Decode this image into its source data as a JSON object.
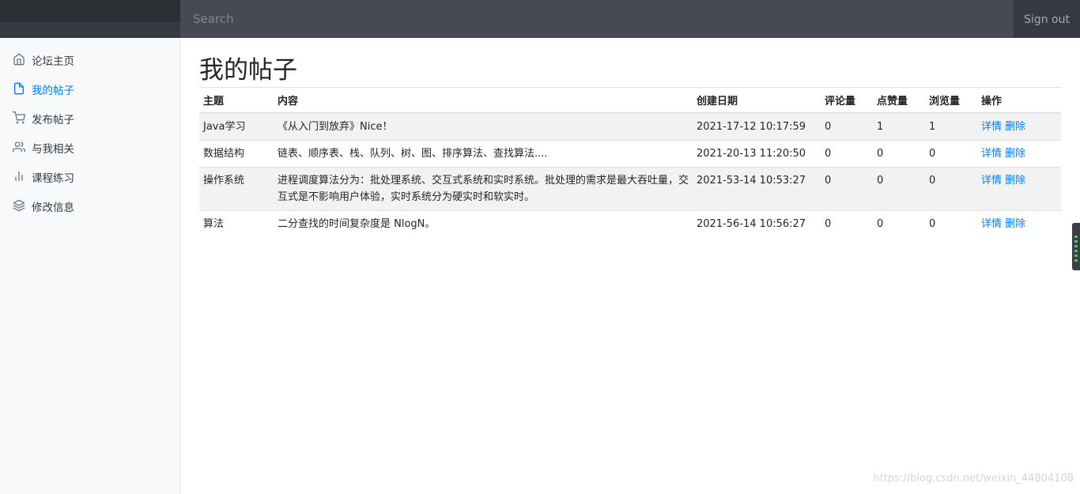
{
  "navbar": {
    "search_placeholder": "Search",
    "signout_label": "Sign out"
  },
  "sidebar": {
    "items": [
      {
        "label": "论坛主页",
        "icon": "home-icon",
        "active": false
      },
      {
        "label": "我的帖子",
        "icon": "file-icon",
        "active": true
      },
      {
        "label": "发布帖子",
        "icon": "shopping-cart-icon",
        "active": false
      },
      {
        "label": "与我相关",
        "icon": "users-icon",
        "active": false
      },
      {
        "label": "课程练习",
        "icon": "bar-chart-icon",
        "active": false
      },
      {
        "label": "修改信息",
        "icon": "layers-icon",
        "active": false
      }
    ]
  },
  "main": {
    "title": "我的帖子",
    "table": {
      "headers": [
        "主题",
        "内容",
        "创建日期",
        "评论量",
        "点赞量",
        "浏览量",
        "操作"
      ],
      "rows": [
        {
          "topic": "Java学习",
          "content": "《从入门到放弃》Nice！",
          "date": "2021-17-12 10:17:59",
          "comments": "0",
          "likes": "1",
          "views": "1",
          "detail": "详情",
          "delete": "删除"
        },
        {
          "topic": "数据结构",
          "content": "链表、顺序表、栈、队列、树、图、排序算法、查找算法....",
          "date": "2021-20-13 11:20:50",
          "comments": "0",
          "likes": "0",
          "views": "0",
          "detail": "详情",
          "delete": "删除"
        },
        {
          "topic": "操作系统",
          "content": "进程调度算法分为：批处理系统、交互式系统和实时系统。批处理的需求是最大吞吐量，交互式是不影响用户体验，实时系统分为硬实时和软实时。",
          "date": "2021-53-14 10:53:27",
          "comments": "0",
          "likes": "0",
          "views": "0",
          "detail": "详情",
          "delete": "删除"
        },
        {
          "topic": "算法",
          "content": "二分查找的时间复杂度是 NlogN。",
          "date": "2021-56-14 10:56:27",
          "comments": "0",
          "likes": "0",
          "views": "0",
          "detail": "详情",
          "delete": "删除"
        }
      ]
    }
  },
  "watermark": "https://blog.csdn.net/weixin_44804108",
  "colors": {
    "navbar_bg": "#343a40",
    "search_bg": "#464b52",
    "sidebar_bg": "#f8f9fa",
    "active_link": "#007bff",
    "row_stripe": "#f2f2f2"
  }
}
